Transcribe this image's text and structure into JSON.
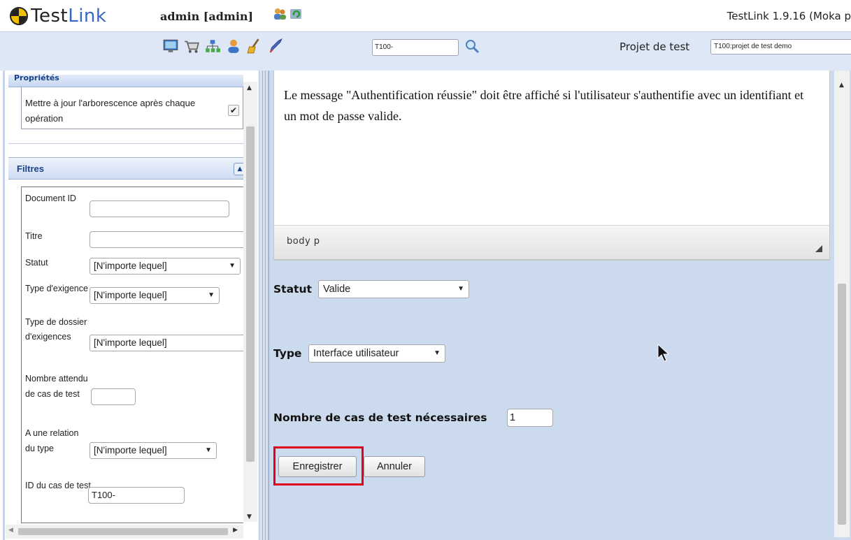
{
  "header": {
    "logo_part1": "Test",
    "logo_part2": "Link",
    "user": "admin [admin]",
    "version": "TestLink 1.9.16 (Moka p",
    "search_value": "T100-",
    "project_label": "Projet de test",
    "project_value": "T100:projet de test demo",
    "toolbar_icons": [
      "desktop-icon",
      "cart-icon",
      "tree-icon",
      "user-icon",
      "broom-icon",
      "rocket-icon"
    ],
    "user_icons": [
      "users-icon",
      "refresh-icon"
    ]
  },
  "left": {
    "properties_title": "Propriétés",
    "update_tree_label": "Mettre à jour l'arborescence après chaque opération",
    "update_tree_checked": true,
    "filters_title": "Filtres",
    "filters": {
      "doc_id_label": "Document ID",
      "doc_id_value": "",
      "title_label": "Titre",
      "title_value": "",
      "status_label": "Statut",
      "status_value": "[N'importe lequel]",
      "req_type_label": "Type d'exigence",
      "req_type_value": "[N'importe lequel]",
      "folder_type_label": "Type de dossier d'exigences",
      "folder_type_value": "[N'importe lequel]",
      "expected_tc_label": "Nombre attendu de cas de test",
      "expected_tc_value": "",
      "relation_label": "A une relation du type",
      "relation_value": "[N'importe lequel]",
      "tc_id_label": "ID du cas de test",
      "tc_id_value": "T100-"
    }
  },
  "editor": {
    "content": "Le message \"Authentification réussie\" doit être affiché si l'utilisateur s'authentifie avec un identifiant et un mot de passe valide.",
    "path": "body  p"
  },
  "form": {
    "status_label": "Statut",
    "status_value": "Valide",
    "type_label": "Type",
    "type_value": "Interface utilisateur",
    "tc_needed_label": "Nombre de cas de test nécessaires",
    "tc_needed_value": "1",
    "save_label": "Enregistrer",
    "cancel_label": "Annuler"
  },
  "colors": {
    "accent_blue": "#15428b",
    "panel_bg": "#ccdaee",
    "highlight_red": "#e0001b"
  }
}
